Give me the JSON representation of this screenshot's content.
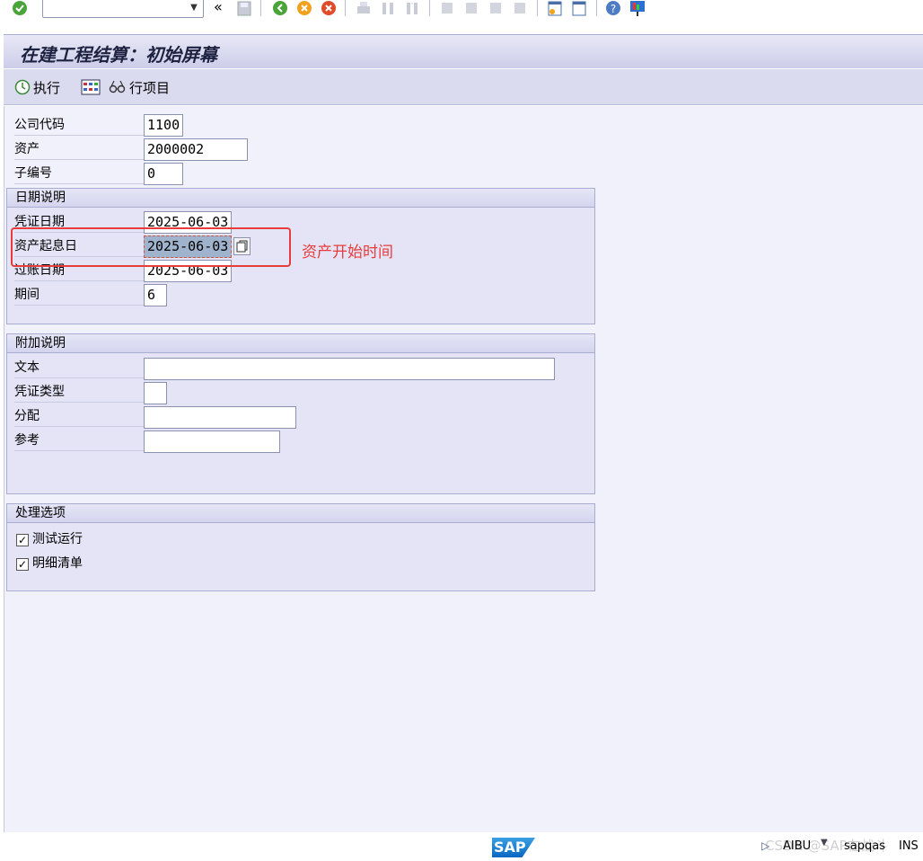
{
  "window_title": "在建工程结算：初始屏幕",
  "app_toolbar": {
    "execute_label": "执行",
    "line_items_label": "行项目"
  },
  "fields": {
    "company_code": {
      "label": "公司代码",
      "value": "1100"
    },
    "asset": {
      "label": "资产",
      "value": "2000002"
    },
    "subnumber": {
      "label": "子编号",
      "value": "0"
    }
  },
  "date_group": {
    "title": "日期说明",
    "document_date": {
      "label": "凭证日期",
      "value": "2025-06-03"
    },
    "asset_value_date": {
      "label": "资产起息日",
      "value": "2025-06-03"
    },
    "posting_date": {
      "label": "过账日期",
      "value": "2025-06-03"
    },
    "period": {
      "label": "期间",
      "value": "6"
    }
  },
  "additional_group": {
    "title": "附加说明",
    "text": {
      "label": "文本",
      "value": ""
    },
    "document_type": {
      "label": "凭证类型",
      "value": ""
    },
    "assignment": {
      "label": "分配",
      "value": ""
    },
    "reference": {
      "label": "参考",
      "value": ""
    }
  },
  "processing_group": {
    "title": "处理选项",
    "test_run": {
      "label": "测试运行",
      "checked": true
    },
    "detail_list": {
      "label": "明细清单",
      "checked": true
    }
  },
  "annotation": "资产开始时间",
  "status": {
    "logo": "SAP",
    "transaction": "AIBU",
    "server": "sapqas",
    "mode": "INS",
    "watermark": "CSDN @SAP在战斗"
  },
  "colors": {
    "annotation_red": "#e83b3b",
    "title_bg": "#cdcdea",
    "group_bg": "#e4e4f6"
  }
}
